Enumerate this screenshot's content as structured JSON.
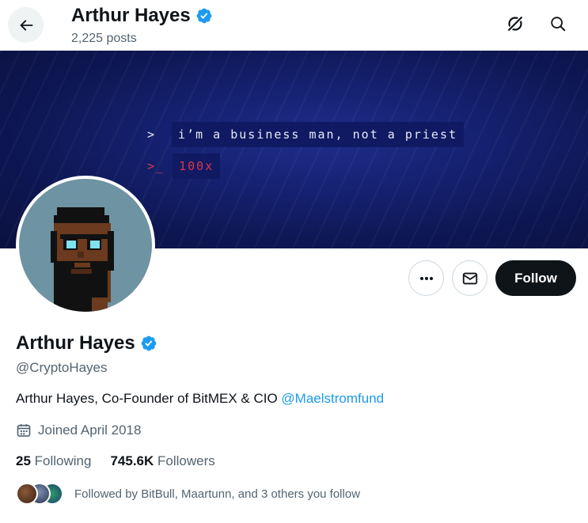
{
  "header": {
    "name": "Arthur Hayes",
    "posts": "2,225 posts",
    "icons": [
      "back-arrow-icon",
      "grok-slash-icon",
      "search-icon"
    ]
  },
  "banner": {
    "line1_prompt": ">",
    "line1_text": "i’m a business man, not a priest",
    "line2_prompt": ">_",
    "line2_text": "100x"
  },
  "actions": {
    "more_icon": "more-dots-icon",
    "message_icon": "envelope-icon",
    "follow_label": "Follow"
  },
  "profile": {
    "name": "Arthur Hayes",
    "handle": "@CryptoHayes",
    "bio_text": "Arthur Hayes, Co-Founder of BitMEX & CIO ",
    "bio_mention": "@Maelstromfund",
    "joined": "Joined April 2018",
    "following_count": "25",
    "following_label": "Following",
    "followers_count": "745.6K",
    "followers_label": "Followers",
    "followed_by": "Followed by BitBull, Maartunn, and 3 others you follow"
  },
  "colors": {
    "accent": "#1d9bf0",
    "verified": "#1d9bf0",
    "follow_bg": "#0f1419",
    "muted_text": "#536471",
    "banner_bg": "#152170",
    "terminal_red": "#e0334a"
  }
}
